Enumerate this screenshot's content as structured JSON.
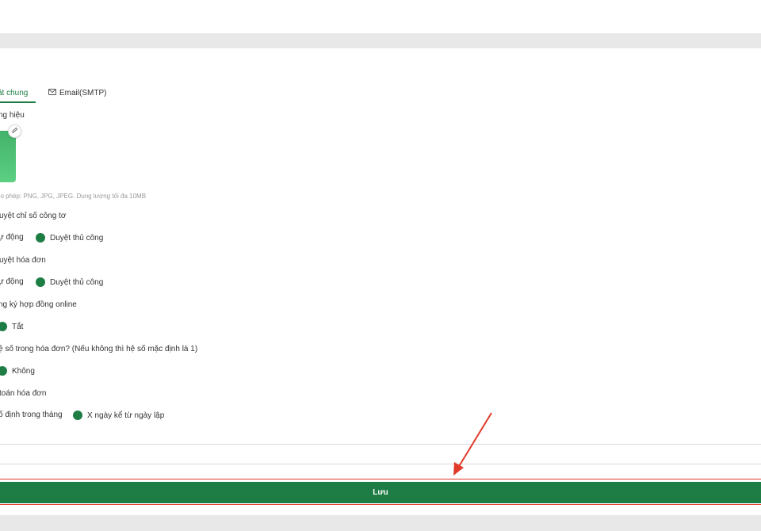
{
  "tabs": {
    "general": "ặt chung",
    "email": "Email(SMTP)"
  },
  "brand": {
    "label": "ng hiệu",
    "hint": "ho phép: PNG, JPG, JPEG. Dung lượng tối đa 10MB"
  },
  "settings": [
    {
      "label": "uyệt chỉ số công tơ",
      "options": [
        "ự động",
        "Duyệt thủ công"
      ]
    },
    {
      "label": "uyệt hóa đơn",
      "options": [
        "ự động",
        "Duyệt thủ công"
      ]
    },
    {
      "label": "ng ký hợp đồng online",
      "options": [
        "Tắt"
      ]
    },
    {
      "label": "ệ số trong hóa đơn? (Nếu không thì hệ số mặc định là 1)",
      "options": [
        "Không"
      ]
    },
    {
      "label": "toán hóa đơn",
      "options": [
        "ố định trong tháng",
        "X ngày kể từ ngày lập"
      ]
    }
  ],
  "save_label": "Lưu",
  "colors": {
    "accent": "#1e7d45",
    "annotation": "#e03a2a"
  },
  "icons": {
    "email": "mail-icon",
    "edit": "pencil-icon"
  }
}
